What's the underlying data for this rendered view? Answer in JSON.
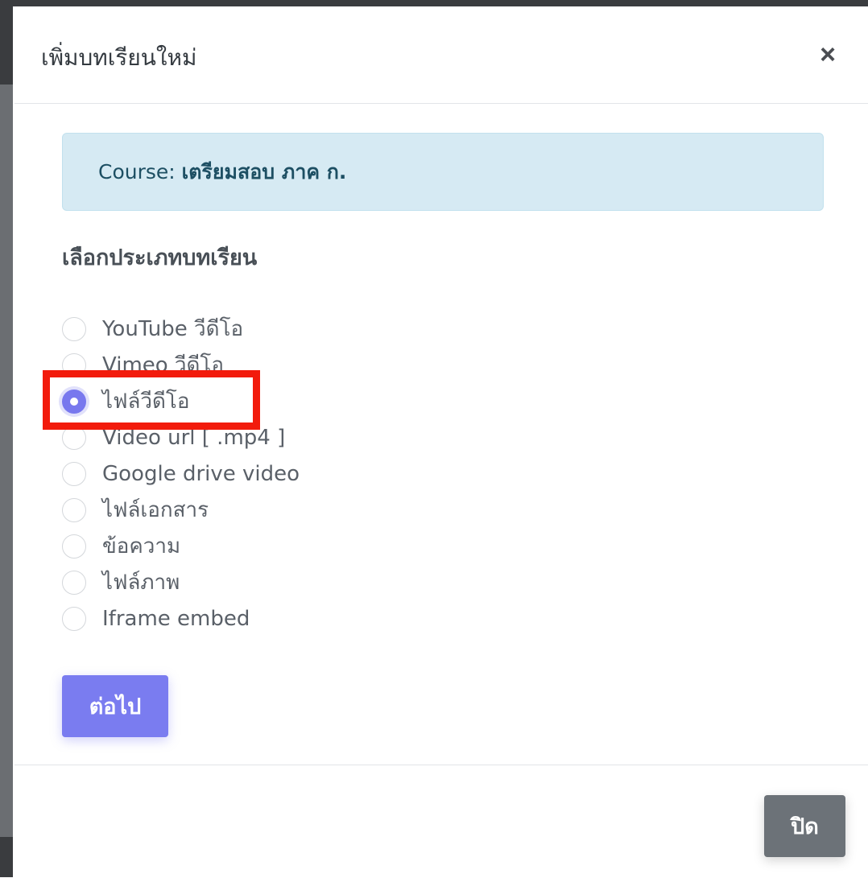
{
  "modal": {
    "title": "เพิ่มบทเรียนใหม่",
    "close_symbol": "×"
  },
  "alert": {
    "prefix": "Course: ",
    "course_name": "เตรียมสอบ ภาค ก."
  },
  "section_label": "เลือกประเภทบทเรียน",
  "options": [
    {
      "label": "YouTube วีดีโอ",
      "checked": false
    },
    {
      "label": "Vimeo วีดีโอ",
      "checked": false
    },
    {
      "label": "ไฟล์วีดีโอ",
      "checked": true
    },
    {
      "label": "Video url [ .mp4 ]",
      "checked": false
    },
    {
      "label": "Google drive video",
      "checked": false
    },
    {
      "label": "ไฟล์เอกสาร",
      "checked": false
    },
    {
      "label": "ข้อความ",
      "checked": false
    },
    {
      "label": "ไฟล์ภาพ",
      "checked": false
    },
    {
      "label": "Iframe embed",
      "checked": false
    }
  ],
  "buttons": {
    "next_label": "ต่อไป",
    "close_label": "ปิด"
  },
  "colors": {
    "primary": "#7a7cf0",
    "secondary": "#6c7278",
    "alert_bg": "#d6eaf3",
    "highlight": "#f21b0c"
  }
}
